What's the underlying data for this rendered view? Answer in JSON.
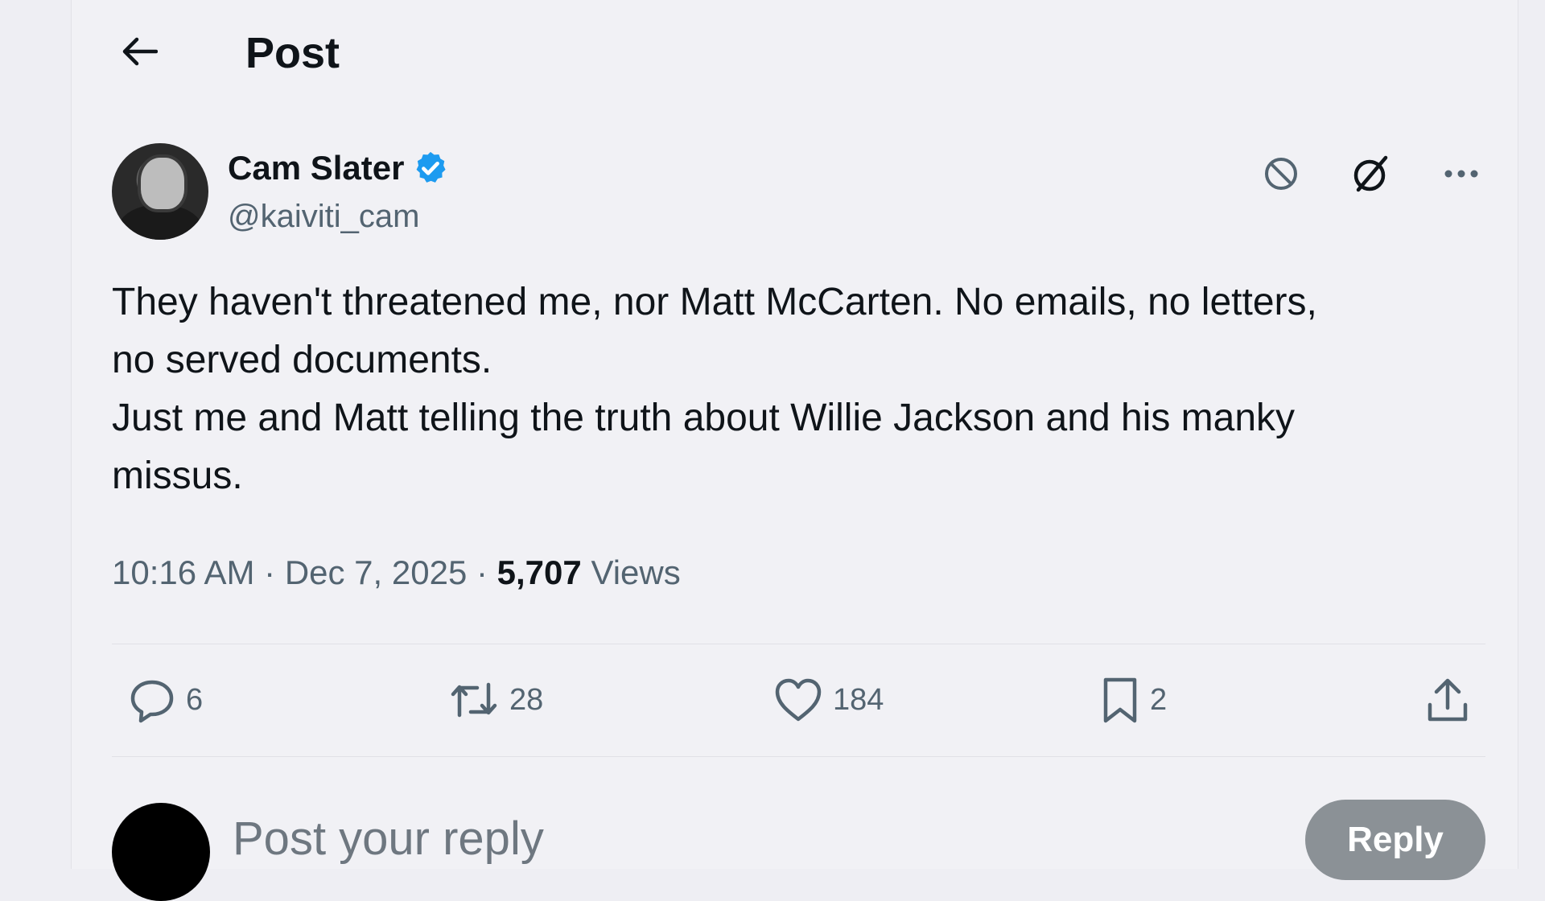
{
  "header": {
    "back_icon": "arrow-left-icon",
    "title": "Post"
  },
  "post": {
    "author": {
      "display_name": "Cam Slater",
      "handle": "@kaiviti_cam",
      "verified": true,
      "verified_color": "#1d9bf0"
    },
    "top_actions": [
      "block-icon",
      "grok-icon",
      "more-icon"
    ],
    "text": "They haven't threatened me, nor Matt McCarten. No emails, no letters,\nno served documents.\nJust me and Matt telling the truth about Willie Jackson and his manky\nmissus.",
    "time": "10:16 AM",
    "separator": "·",
    "date": "Dec 7, 2025",
    "views_count": "5,707",
    "views_label": "Views"
  },
  "actions": {
    "replies": "6",
    "reposts": "28",
    "likes": "184",
    "bookmarks": "2",
    "share_icon": "share-icon"
  },
  "reply_box": {
    "placeholder": "Post your reply",
    "button_label": "Reply",
    "button_color": "#8b9196"
  }
}
